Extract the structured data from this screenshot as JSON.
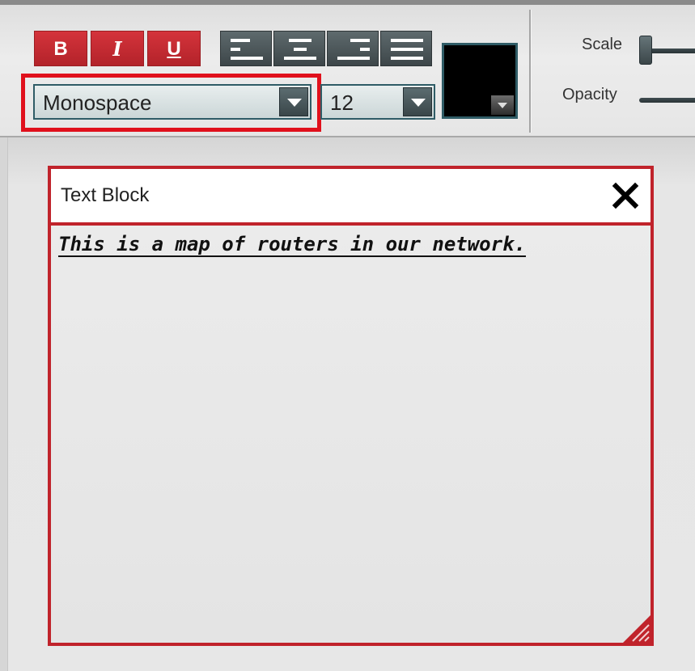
{
  "toolbar": {
    "bold_label": "B",
    "italic_label": "I",
    "underline_label": "U",
    "align_icons": [
      "align-left-icon",
      "align-center-icon",
      "align-right-icon",
      "align-justify-icon"
    ],
    "font_family": {
      "value": "Monospace"
    },
    "font_size": {
      "value": "12"
    },
    "text_color": "#000000",
    "scale_label": "Scale",
    "opacity_label": "Opacity"
  },
  "colors": {
    "accent_red": "#c0232b",
    "highlight_red": "#e0101c",
    "control_dark": "#3d4649"
  },
  "panel": {
    "title": "Text Block",
    "close_icon": "close-icon",
    "content": "This is a map of routers in our network.",
    "content_style": {
      "bold": true,
      "italic": true,
      "underline": true
    }
  }
}
